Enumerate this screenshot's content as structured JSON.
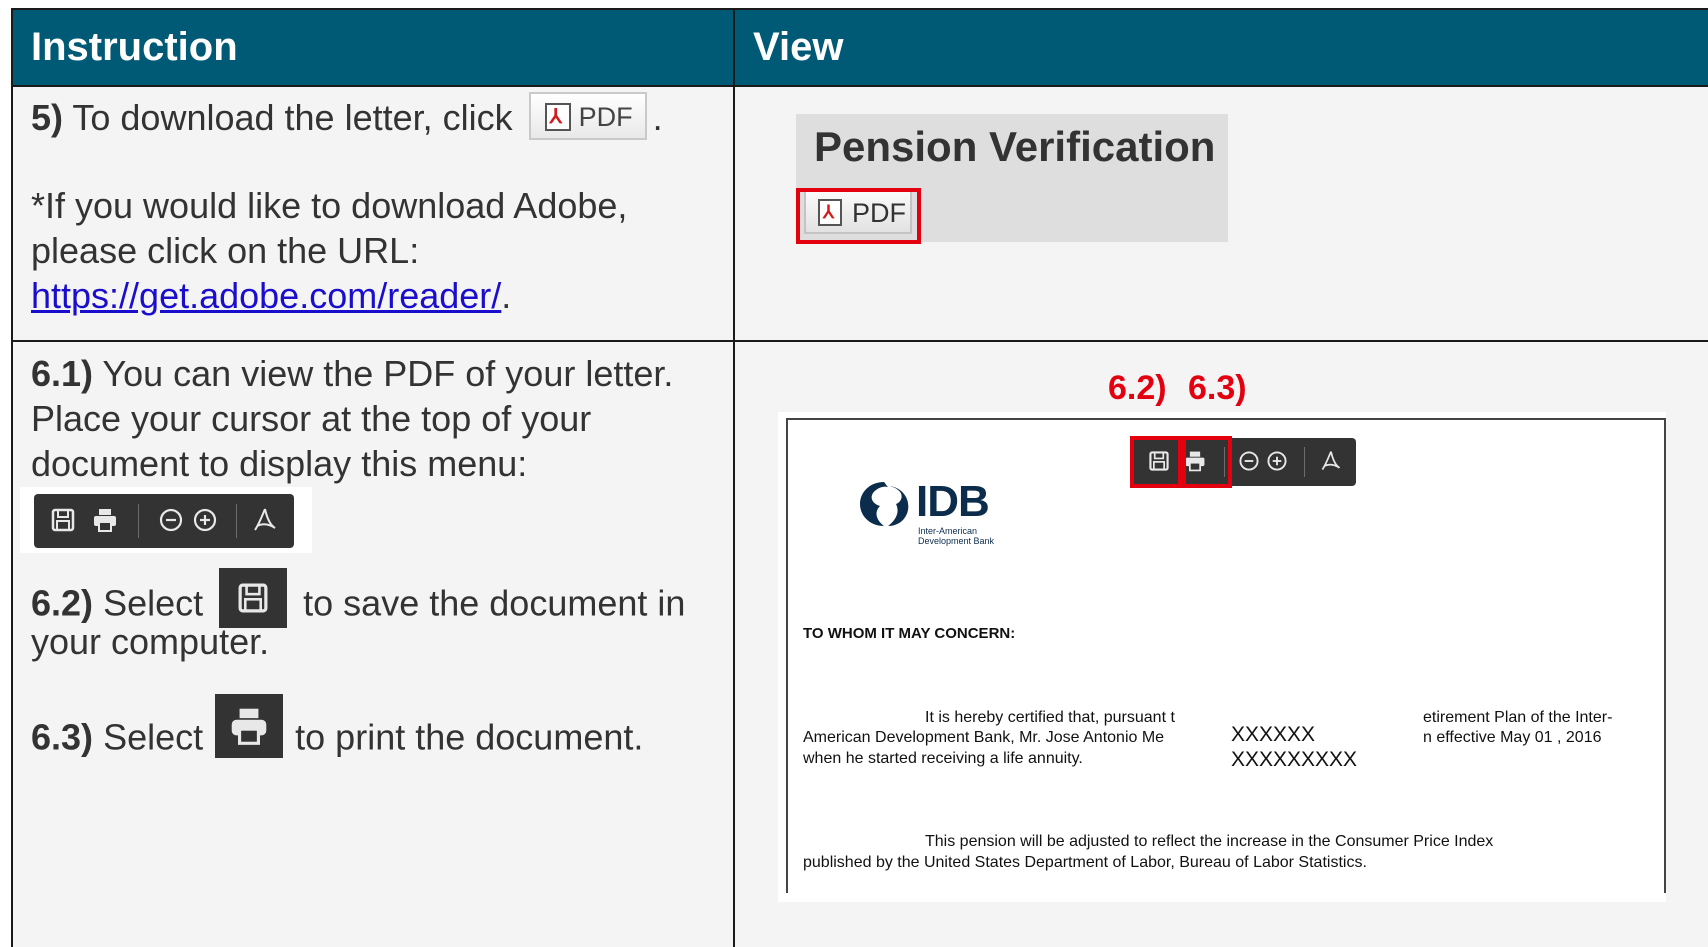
{
  "header": {
    "col1": "Instruction",
    "col2": "View"
  },
  "step5": {
    "num": "5)",
    "text_before": "To download the letter, click",
    "text_after": ".",
    "pdf_button_label": "PDF",
    "adobe_line1": "*If you would like to download Adobe,",
    "adobe_line2": "please click on the URL:",
    "adobe_url": "https://get.adobe.com/reader/",
    "adobe_url_after": "."
  },
  "step6": {
    "num1": "6.1)",
    "line1": "You can view the PDF of your letter.",
    "line2": "Place your cursor at the top of your",
    "line3": "document to display this menu:",
    "num2": "6.2)",
    "save_before": "Select",
    "save_after": "to save the document in",
    "save_line2": "your computer.",
    "num3": "6.3)",
    "print_before": "Select",
    "print_after": "to print the document."
  },
  "view5": {
    "title": "Pension Verification",
    "pdf_button_label": "PDF"
  },
  "view6": {
    "callout1": "6.2)",
    "callout2": "6.3)",
    "logo_text": "IDB",
    "logo_sub1": "Inter-American",
    "logo_sub2": "Development Bank",
    "salutation": "TO WHOM IT MAY CONCERN:",
    "para1_l1a": "It is hereby certified that, pursuant t",
    "para1_l1b": "etirement Plan of the Inter-",
    "para1_l2a": "American Development Bank, Mr. Jose Antonio Me",
    "para1_l2b": "n effective May 01 , 2016",
    "para1_l3": "when he started receiving a life annuity.",
    "redact1": "XXXXXX",
    "redact2": "XXXXXXXXX",
    "para2_l1": "This pension will be adjusted to reflect the increase in the Consumer Price Index",
    "para2_l2": "published by the United States Department of Labor, Bureau of Labor Statistics."
  },
  "icons": [
    "save-icon",
    "print-icon",
    "zoom-out-icon",
    "zoom-in-icon",
    "adobe-acrobat-icon",
    "pdf-icon",
    "idb-logo-icon"
  ],
  "colors": {
    "header_bg": "#005a76",
    "accent_red": "#e3000f",
    "toolbar_bg": "#333333",
    "link": "#1a0dcc"
  }
}
